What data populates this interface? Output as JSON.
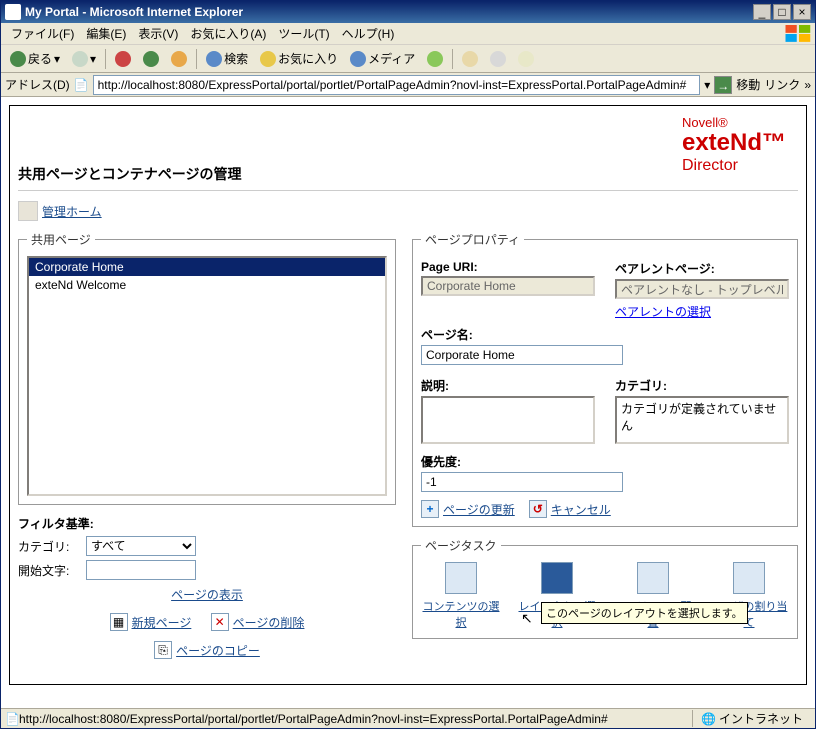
{
  "window": {
    "title": "My Portal - Microsoft Internet Explorer"
  },
  "menubar": {
    "items": [
      "ファイル(F)",
      "編集(E)",
      "表示(V)",
      "お気に入り(A)",
      "ツール(T)",
      "ヘルプ(H)"
    ]
  },
  "toolbar": {
    "back": "戻る",
    "search": "検索",
    "favorites": "お気に入り",
    "media": "メディア"
  },
  "addrbar": {
    "label": "アドレス(D)",
    "url": "http://localhost:8080/ExpressPortal/portal/portlet/PortalPageAdmin?novl-inst=ExpressPortal.PortalPageAdmin#",
    "go": "移動",
    "links": "リンク"
  },
  "brand": {
    "l1": "Novell®",
    "l2": "exteNd™",
    "l3": "Director"
  },
  "page_title": "共用ページとコンテナページの管理",
  "home_link": "管理ホーム",
  "shared_pages": {
    "legend": "共用ページ",
    "items": [
      "Corporate Home",
      "exteNd Welcome"
    ],
    "selected_index": 0
  },
  "filter": {
    "legend": "フィルタ基準:",
    "category_label": "カテゴリ:",
    "category_value": "すべて",
    "startchar_label": "開始文字:",
    "startchar_value": "",
    "show_pages": "ページの表示"
  },
  "page_props": {
    "legend": "ページプロパティ",
    "uri_label": "Page URI:",
    "uri_value": "Corporate Home",
    "parent_label": "ペアレントページ:",
    "parent_value": "ペアレントなし - トップレベル",
    "parent_select": "ペアレントの選択",
    "name_label": "ページ名:",
    "name_value": "Corporate Home",
    "desc_label": "説明:",
    "desc_value": "",
    "category_label": "カテゴリ:",
    "category_text": "カテゴリが定義されていません",
    "priority_label": "優先度:",
    "priority_value": "-1",
    "update": "ページの更新",
    "cancel": "キャンセル"
  },
  "page_tasks": {
    "legend": "ページタスク",
    "items": [
      "コンテンツの選択",
      "レイアウトの選択",
      "コンテンツの配置",
      "ユーザの割り当て"
    ],
    "tooltip": "このページのレイアウトを選択します。"
  },
  "bottom_links": {
    "new_page": "新規ページ",
    "delete_page": "ページの削除",
    "copy_page": "ページのコピー"
  },
  "statusbar": {
    "text": "http://localhost:8080/ExpressPortal/portal/portlet/PortalPageAdmin?novl-inst=ExpressPortal.PortalPageAdmin#",
    "zone": "イントラネット"
  }
}
